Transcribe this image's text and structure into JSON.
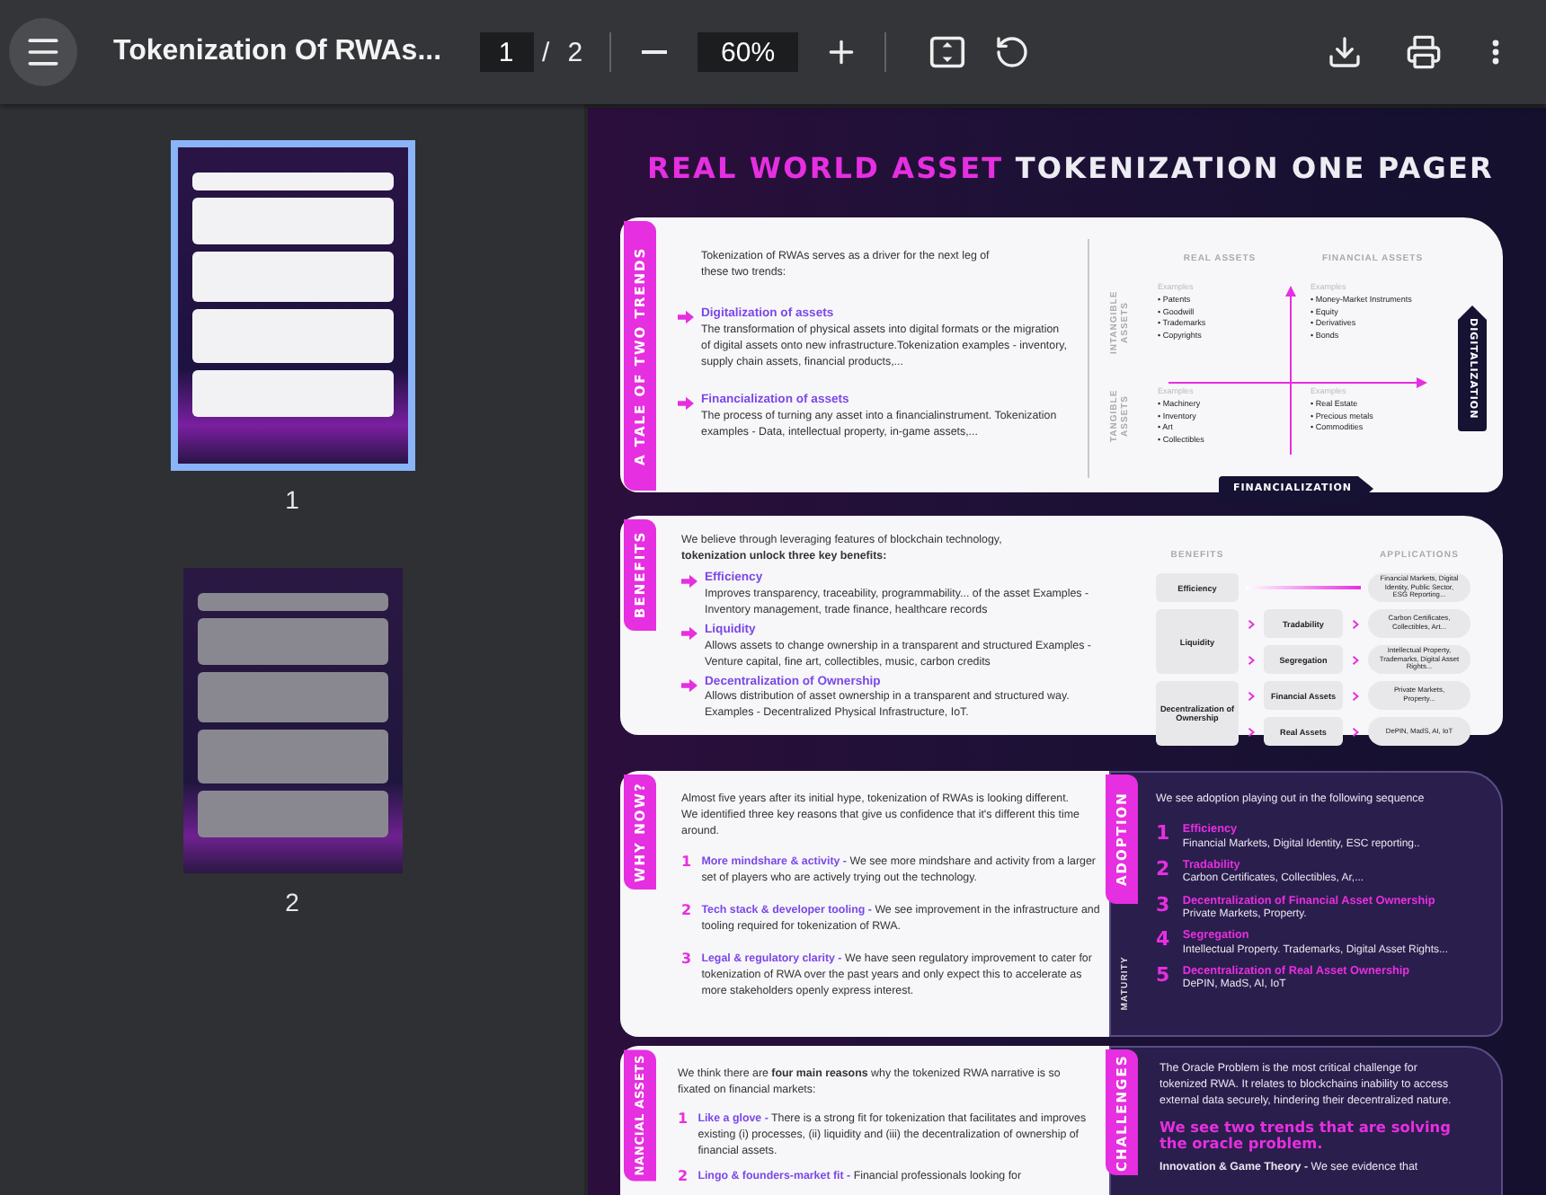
{
  "toolbar": {
    "title": "Tokenization Of RWAs...",
    "page_input": "1",
    "page_separator": "/",
    "page_count": "2",
    "zoom": "60%"
  },
  "thumbnails": [
    {
      "label": "1",
      "selected": true,
      "kind": "light"
    },
    {
      "label": "2",
      "selected": false,
      "kind": "grey"
    }
  ],
  "document": {
    "title_highlight": "REAL WORLD ASSET",
    "title_rest": "TOKENIZATION ONE PAGER",
    "trends": {
      "tab": "A TALE OF TWO TRENDS",
      "intro": "Tokenization of RWAs serves as a driver for the next leg of these two trends:",
      "items": [
        {
          "heading": "Digitalization of assets",
          "text": "The transformation of physical assets into digital formats or the migration of digital assets onto new infrastructure.Tokenization examples - inventory, supply chain assets, financial products,..."
        },
        {
          "heading": "Financialization of assets",
          "text": "The process of turning any asset into a financialinstrument. Tokenization examples - Data, intellectual property, in-game assets,..."
        }
      ],
      "quadrant": {
        "col_headers": [
          "REAL ASSETS",
          "FINANCIAL ASSETS"
        ],
        "row_headers": [
          "INTANGIBLE ASSETS",
          "TANGIBLE ASSETS"
        ],
        "cells": [
          {
            "label": "Examples",
            "items": [
              "• Patents",
              "• Goodwill",
              "• Trademarks",
              "• Copyrights"
            ]
          },
          {
            "label": "Examples",
            "items": [
              "• Money-Market Instruments",
              "• Equity",
              "• Derivatives",
              "• Bonds"
            ]
          },
          {
            "label": "Examples",
            "items": [
              "• Machinery",
              "• Inventory",
              "• Art",
              "• Collectibles"
            ]
          },
          {
            "label": "Examples",
            "items": [
              "• Real Estate",
              "• Precious metals",
              "• Commodities"
            ]
          }
        ],
        "y_axis": "DIGITALIZATION",
        "x_axis": "FINANCIALIZATION"
      }
    },
    "benefits": {
      "tab": "BENEFITS",
      "intro": "We believe through leveraging features of blockchain technology, **tokenization unlock three key benefits:**",
      "items": [
        {
          "heading": "Efficiency",
          "text": "Improves transparency, traceability, programmability... of the asset Examples - Inventory management, trade finance, healthcare records"
        },
        {
          "heading": "Liquidity",
          "text": "Allows assets to change ownership in a transparent and structured Examples - Venture capital, fine art, collectibles, music, carbon credits"
        },
        {
          "heading": "Decentralization of Ownership",
          "text": "Allows distribution of asset ownership in a transparent and structured way. Examples - Decentralized Physical Infrastructure, IoT."
        }
      ],
      "table": {
        "headers": [
          "BENEFITS",
          "APPLICATIONS"
        ],
        "groups": [
          {
            "benefit": "Efficiency",
            "rows": [
              {
                "app": "Financial Markets, Digital Identity, Public Sector, ESG Reporting..."
              }
            ]
          },
          {
            "benefit": "Liquidity",
            "rows": [
              {
                "feature": "Tradability",
                "app": "Carbon Certificates, Collectibles, Art..."
              },
              {
                "feature": "Segregation",
                "app": "Intellectual Property, Trademarks, Digital Asset Rights..."
              }
            ]
          },
          {
            "benefit": "Decentralization of Ownership",
            "rows": [
              {
                "feature": "Financial Assets",
                "app": "Private Markets, Property..."
              },
              {
                "feature": "Real Assets",
                "app": "DePIN, MadS, AI, IoT"
              }
            ]
          }
        ]
      }
    },
    "why_now": {
      "tab": "WHY NOW?",
      "intro": "Almost five years after its initial hype, tokenization of RWAs is looking different. We identified three key reasons that give us confidence that it's different this time around.",
      "items": [
        {
          "number": "1",
          "heading": "More mindshare & activity -",
          "text": "We see more mindshare and activity from a larger set of players who are actively trying out the technology."
        },
        {
          "number": "2",
          "heading": "Tech stack & developer tooling -",
          "text": "We see improvement in the infrastructure and tooling required for tokenization of RWA."
        },
        {
          "number": "3",
          "heading": "Legal & regulatory clarity -",
          "text": "We have seen regulatory improvement to cater for tokenization of RWA over the past years and only expect this to accelerate as more stakeholders openly express interest."
        }
      ]
    },
    "adoption": {
      "tab": "ADOPTION",
      "intro": "We see adoption playing out in the following sequence",
      "axis": "MATURITY",
      "steps": [
        {
          "number": "1",
          "heading": "Efficiency",
          "text": "Financial Markets, Digital Identity, ESC reporting.."
        },
        {
          "number": "2",
          "heading": "Tradability",
          "text": "Carbon Certificates, Collectibles, Ar,..."
        },
        {
          "number": "3",
          "heading": "Decentralization of Financial Asset Ownership",
          "text": "Private Markets, Property."
        },
        {
          "number": "4",
          "heading": "Segregation",
          "text": "Intellectual Property. Trademarks, Digital Asset Rights..."
        },
        {
          "number": "5",
          "heading": "Decentralization of Real Asset Ownership",
          "text": "DePIN, MadS, AI, IoT"
        }
      ]
    },
    "financial_assets": {
      "tab": "NANCIAL ASSETS",
      "intro": "We think there are **four main reasons** why the tokenized RWA narrative is so fixated on financial markets:",
      "items": [
        {
          "number": "1",
          "heading": "Like a glove -",
          "text": "There is a strong fit for tokenization that facilitates and improves existing (i) processes, (ii) liquidity and (iii) the decentralization of ownership of financial assets."
        },
        {
          "number": "2",
          "heading": "Lingo & founders-market fit -",
          "text": "Financial professionals looking for"
        }
      ]
    },
    "challenges": {
      "tab": "CHALLENGES",
      "text": "The Oracle Problem is the most critical challenge for tokenized RWA. It relates to blockchains inability to access external data securely, hindering their decentralized nature.",
      "highlight": "We see two trends that are solving the oracle problem.",
      "item": {
        "heading": "Innovation & Game Theory -",
        "text": "We see evidence that"
      }
    }
  }
}
